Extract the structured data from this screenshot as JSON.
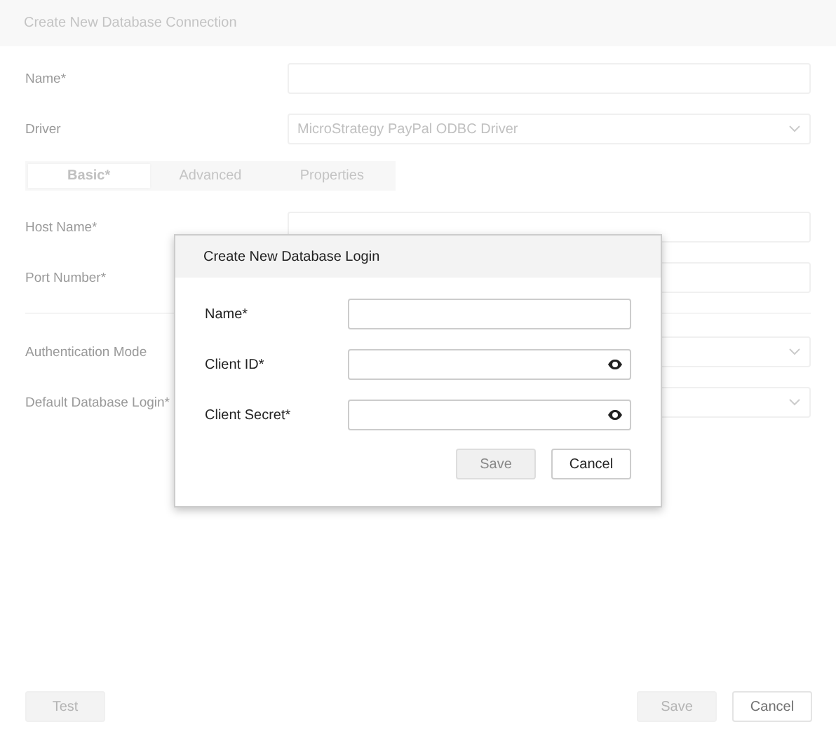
{
  "window": {
    "title": "Create New Database Connection"
  },
  "top_fields": [
    {
      "label": "Name*",
      "kind": "text"
    },
    {
      "label": "Driver",
      "kind": "select",
      "value": "MicroStrategy PayPal ODBC Driver"
    }
  ],
  "tabs": [
    {
      "label": "Basic*",
      "selected": true
    },
    {
      "label": "Advanced",
      "selected": false
    },
    {
      "label": "Properties",
      "selected": false
    }
  ],
  "basic_fields": [
    {
      "label": "Host Name*",
      "kind": "text"
    },
    {
      "label": "Port Number*",
      "kind": "text"
    }
  ],
  "auth_fields": [
    {
      "label": "Authentication Mode",
      "kind": "select"
    },
    {
      "label": "Default Database Login*",
      "kind": "select"
    }
  ],
  "footer_left": [
    {
      "label": "Test",
      "disabled": true
    }
  ],
  "footer_right": [
    {
      "label": "Save",
      "disabled": true
    },
    {
      "label": "Cancel",
      "disabled": false
    }
  ],
  "dialog": {
    "title": "Create New Database Login",
    "fields": [
      {
        "label": "Name*",
        "kind": "text"
      },
      {
        "label": "Client ID*",
        "kind": "secret"
      },
      {
        "label": "Client Secret*",
        "kind": "secret"
      }
    ],
    "buttons": [
      {
        "label": "Save",
        "disabled": true
      },
      {
        "label": "Cancel",
        "disabled": false
      }
    ]
  }
}
